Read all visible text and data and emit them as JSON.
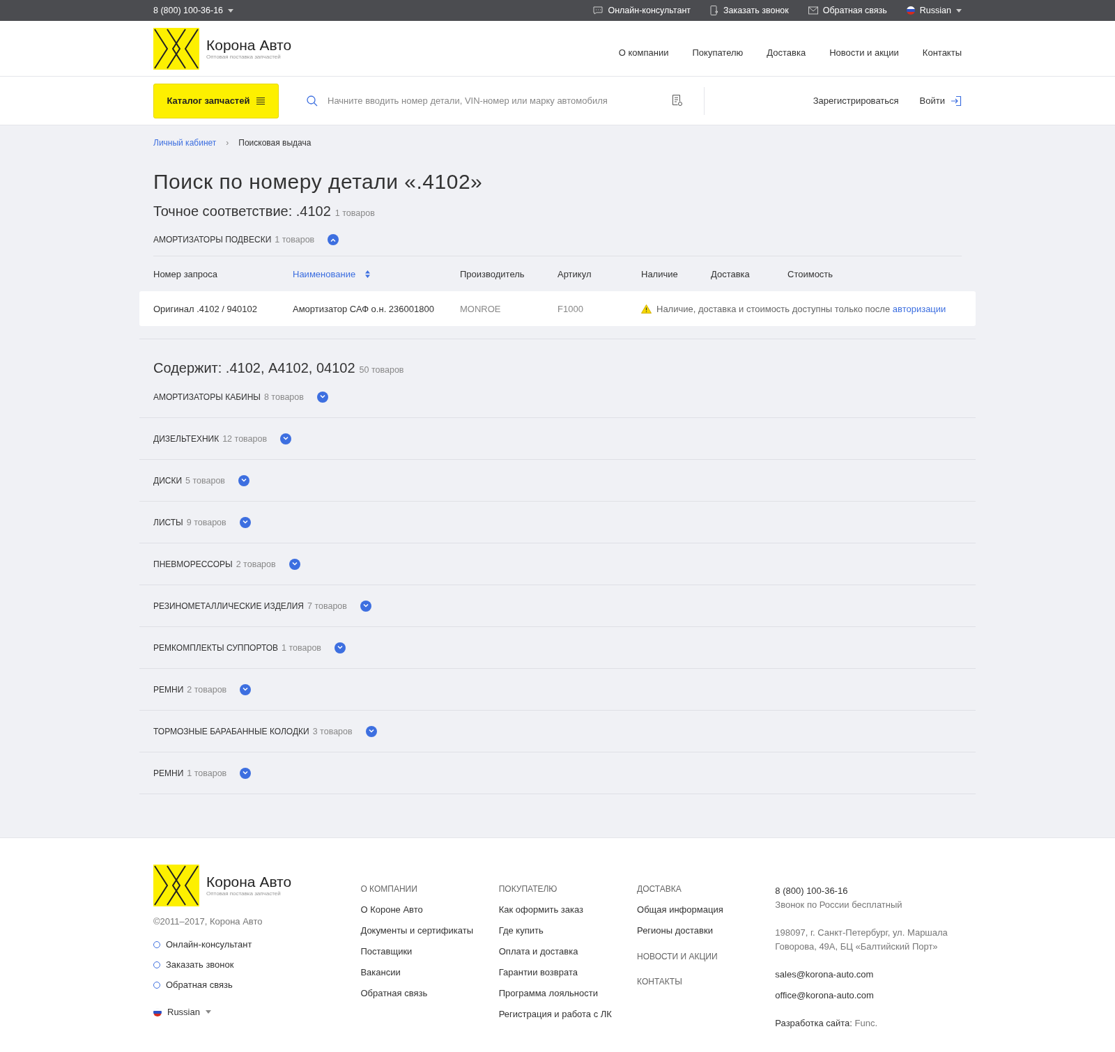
{
  "topbar": {
    "phone": "8 (800) 100-36-16",
    "links": [
      {
        "kind": "chat",
        "label": "Онлайн-консультант"
      },
      {
        "kind": "call",
        "label": "Заказать звонок"
      },
      {
        "kind": "mail",
        "label": "Обратная связь"
      }
    ],
    "language": "Russian"
  },
  "header": {
    "logo": {
      "name": "Корона Авто",
      "tagline": "Оптовая поставка запчастей"
    },
    "nav": [
      "О компании",
      "Покупателю",
      "Доставка",
      "Новости и акции",
      "Контакты"
    ]
  },
  "toolbar": {
    "catalog_button": "Каталог запчастей",
    "search": {
      "placeholder": "Начните вводить номер детали, VIN-номер или марку автомобиля"
    },
    "register": "Зарегистрироваться",
    "login": "Войти"
  },
  "breadcrumb_separator": "›",
  "breadcrumbs": [
    {
      "label": "Личный кабинет",
      "kind": "link"
    },
    {
      "label": "Поисковая выдача",
      "kind": "current"
    }
  ],
  "title": "Поиск по номеру детали «.4102»",
  "exact": {
    "heading": "Точное соответствие: .4102",
    "count": "1 товаров",
    "groups": [
      {
        "name": "АМОРТИЗАТОРЫ ПОДВЕСКИ",
        "count": "1 товаров",
        "expanded": true
      }
    ],
    "table": {
      "columns": [
        {
          "label": "Номер запроса",
          "sorted": false
        },
        {
          "label": "Наименование",
          "sorted": true
        },
        {
          "label": "Производитель",
          "sorted": false
        },
        {
          "label": "Артикул",
          "sorted": false
        },
        {
          "label": "Наличие",
          "sorted": false
        },
        {
          "label": "Доставка",
          "sorted": false
        },
        {
          "label": "Стоимость",
          "sorted": false
        }
      ],
      "rows": [
        {
          "request": "Оригинал .4102 / 940102",
          "name": "Амортизатор САФ о.н. 236001800",
          "maker": "MONROE",
          "article": "F1000",
          "notice": "Наличие, доставка и стоимость доступны только после",
          "notice_link": "авторизации"
        }
      ]
    }
  },
  "contains": {
    "heading": "Содержит: .4102, А4102, 04102",
    "count": "50 товаров",
    "groups": [
      {
        "name": "АМОРТИЗАТОРЫ КАБИНЫ",
        "count": "8 товаров",
        "expanded": false
      },
      {
        "name": "ДИЗЕЛЬТЕХНИК",
        "count": "12 товаров",
        "expanded": false
      },
      {
        "name": "ДИСКИ",
        "count": "5 товаров",
        "expanded": false
      },
      {
        "name": "ЛИСТЫ",
        "count": "9 товаров",
        "expanded": false
      },
      {
        "name": "ПНЕВМОРЕССОРЫ",
        "count": "2 товаров",
        "expanded": false
      },
      {
        "name": "РЕЗИНОМЕТАЛЛИЧЕСКИЕ ИЗДЕЛИЯ",
        "count": "7 товаров",
        "expanded": false
      },
      {
        "name": "РЕМКОМПЛЕКТЫ СУППОРТОВ",
        "count": "1 товаров",
        "expanded": false
      },
      {
        "name": "РЕМНИ",
        "count": "2 товаров",
        "expanded": false
      },
      {
        "name": "ТОРМОЗНЫЕ БАРАБАННЫЕ КОЛОДКИ",
        "count": "3 товаров",
        "expanded": false
      },
      {
        "name": "РЕМНИ",
        "count": "1 товаров",
        "expanded": false
      }
    ]
  },
  "footer": {
    "logo": {
      "name": "Корона Авто",
      "tagline": "Оптовая поставка запчастей"
    },
    "copyright": "©2011–2017, Корона Авто",
    "links": [
      "Онлайн-консультант",
      "Заказать звонок",
      "Обратная связь"
    ],
    "language": "Russian",
    "columns": [
      {
        "sections": [
          {
            "heading": "О КОМПАНИИ",
            "items": [
              "О Короне Авто",
              "Документы и сертификаты",
              "Поставщики",
              "Вакансии",
              "Обратная связь"
            ]
          }
        ]
      },
      {
        "sections": [
          {
            "heading": "ПОКУПАТЕЛЮ",
            "items": [
              "Как оформить заказ",
              "Где купить",
              "Оплата и доставка",
              "Гарантии возврата",
              "Программа лояльности",
              "Регистрация и работа с ЛК"
            ]
          }
        ]
      },
      {
        "sections": [
          {
            "heading": "ДОСТАВКА",
            "items": [
              "Общая информация",
              "Регионы доставки"
            ]
          },
          {
            "heading": "НОВОСТИ И АКЦИИ"
          },
          {
            "heading": "КОНТАКТЫ"
          }
        ]
      }
    ],
    "contacts": {
      "phone": "8 (800) 100-36-16",
      "phone_note": "Звонок по России бесплатный",
      "address": "198097, г. Санкт-Петербург, ул. Маршала Говорова, 49А, БЦ «Балтийский Порт»",
      "emails": [
        "sales@korona-auto.com",
        "office@korona-auto.com"
      ],
      "developer_label": "Разработка сайта:",
      "developer": "Func."
    }
  }
}
